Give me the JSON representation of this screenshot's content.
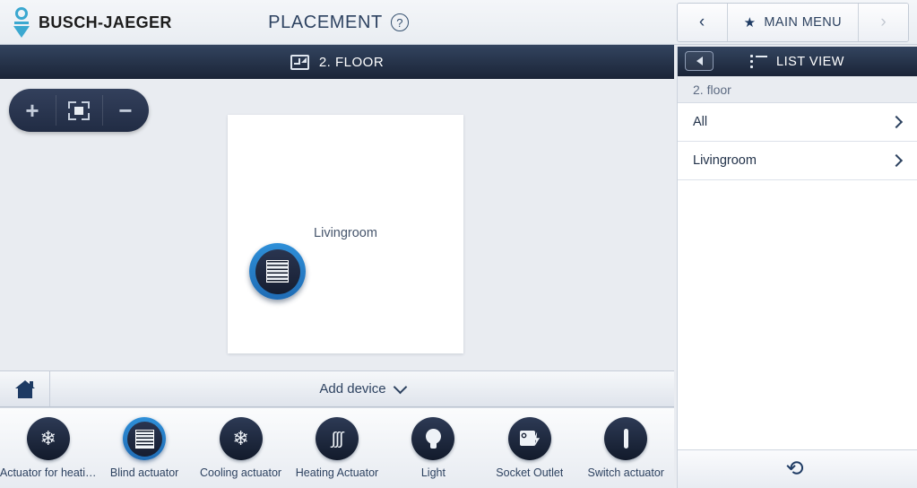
{
  "header": {
    "brand": "BUSCH-JAEGER",
    "brand_icon": "busch-jaeger-logo",
    "page_title": "PLACEMENT",
    "help_icon": "?",
    "nav_prev_icon": "‹",
    "nav_next_icon": "›",
    "star_icon": "★",
    "main_menu_label": "MAIN MENU"
  },
  "floorbar": {
    "icon": "floor-swap-icon",
    "title": "2. FLOOR"
  },
  "zoom_controls": {
    "zoom_in_icon": "+",
    "fit_icon": "fit-to-screen-icon",
    "zoom_out_icon": "−"
  },
  "canvas": {
    "room": {
      "name": "Livingroom",
      "device": {
        "type": "blind-actuator",
        "selected": true
      }
    }
  },
  "add_row": {
    "house_icon": "house-icon",
    "label": "Add device",
    "chevron_icon": "chevron-down-icon"
  },
  "palette": {
    "items": [
      {
        "label": "Actuator for heati…",
        "icon": "heat-cool-actuator-icon",
        "selected": false
      },
      {
        "label": "Blind actuator",
        "icon": "blind-actuator-icon",
        "selected": true
      },
      {
        "label": "Cooling actuator",
        "icon": "snowflake-icon",
        "selected": false
      },
      {
        "label": "Heating Actuator",
        "icon": "heat-waves-icon",
        "selected": false
      },
      {
        "label": "Light",
        "icon": "lightbulb-icon",
        "selected": false
      },
      {
        "label": "Socket Outlet",
        "icon": "socket-outlet-icon",
        "selected": false
      },
      {
        "label": "Switch actuator",
        "icon": "switch-actuator-icon",
        "selected": false
      }
    ]
  },
  "sidebar": {
    "collapse_icon": "collapse-panel-icon",
    "list_icon": "list-view-icon",
    "title": "LIST VIEW",
    "subheader": "2. floor",
    "rows": [
      {
        "label": "All",
        "chevron": "chevron-right-icon"
      },
      {
        "label": "Livingroom",
        "chevron": "chevron-right-icon"
      }
    ],
    "back_icon": "back-arrow-icon"
  },
  "colors": {
    "accent_blue": "#1f6cb5",
    "dark_navy": "#1a2437",
    "canvas_bg": "#e9ecf1",
    "brand_cyan": "#3ba8d0"
  }
}
